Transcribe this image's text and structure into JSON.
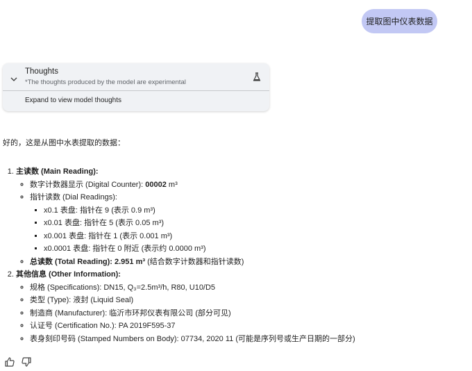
{
  "user_message": "提取图中仪表数据",
  "thoughts": {
    "title": "Thoughts",
    "subtitle": "*The thoughts produced by the model are experimental",
    "expand_label": "Expand to view model thoughts"
  },
  "response": {
    "intro": "好的，这是从图中水表提取的数据：",
    "section1": {
      "title": "主读数 (Main Reading):",
      "digital": {
        "label": "数字计数器显示 (Digital Counter): ",
        "value": "00002",
        "unit": " m³"
      },
      "dial_label": "指针读数 (Dial Readings):",
      "dials": [
        "x0.1 表盘: 指针在 9 (表示 0.9 m³)",
        "x0.01 表盘: 指针在 5 (表示 0.05 m³)",
        "x0.001 表盘: 指针在 1 (表示 0.001 m³)",
        "x0.0001 表盘: 指针在 0 附近 (表示约 0.0000 m³)"
      ],
      "total": {
        "label": "总读数 (Total Reading): 2.951 m³",
        "note": " (结合数字计数器和指针读数)"
      }
    },
    "section2": {
      "title": "其他信息 (Other Information):",
      "items": [
        "规格 (Specifications): DN15, Q₃=2.5m³/h, R80, U10/D5",
        "类型 (Type): 液封 (Liquid Seal)",
        "制造商 (Manufacturer): 临沂市环邦仪表有限公司 (部分可见)",
        "认证号 (Certification No.): PA 2019F595-37",
        "表身刻印号码 (Stamped Numbers on Body): 07734, 2020 11 (可能是序列号或生产日期的一部分)"
      ]
    }
  },
  "icons": {
    "thumb_up": "thumb-up-icon",
    "thumb_down": "thumb-down-icon",
    "chevron": "chevron-down-icon",
    "flask": "flask-icon"
  }
}
